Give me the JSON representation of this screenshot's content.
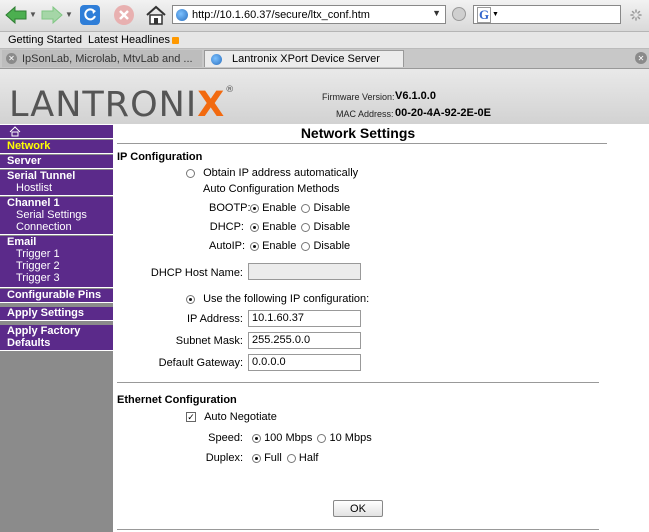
{
  "browser": {
    "url": "http://10.1.60.37/secure/ltx_conf.htm",
    "search_engine": "G",
    "bookmarks": [
      "Getting Started",
      "Latest Headlines"
    ],
    "tabs": [
      {
        "label": "IpSonLab, Microlab, MtvLab and ..."
      },
      {
        "label": "Lantronix XPort Device Server"
      }
    ],
    "colors": {
      "back": "#4caf50",
      "stop": "#d9534f"
    }
  },
  "header": {
    "logo_main": "LANTRONI",
    "logo_x": "X",
    "logo_reg": "®",
    "firmware_label": "Firmware Version:",
    "firmware_value": "V6.1.0.0",
    "mac_label": "MAC Address:",
    "mac_value": "00-20-4A-92-2E-0E"
  },
  "sidebar": {
    "items": [
      {
        "label": "Network"
      },
      {
        "label": "Server"
      },
      {
        "label": "Serial Tunnel"
      },
      {
        "label": "Hostlist"
      },
      {
        "label": "Channel 1"
      },
      {
        "label": "Serial Settings"
      },
      {
        "label": "Connection"
      },
      {
        "label": "Email"
      },
      {
        "label": "Trigger 1"
      },
      {
        "label": "Trigger 2"
      },
      {
        "label": "Trigger 3"
      },
      {
        "label": "Configurable Pins"
      },
      {
        "label": "Apply Settings"
      },
      {
        "label": "Apply Factory"
      },
      {
        "label": "Defaults"
      }
    ],
    "active_color": "#ffff00",
    "bg_color": "#5b2a8a"
  },
  "main": {
    "title": "Network Settings",
    "ip_section": "IP Configuration",
    "obtain_auto": "Obtain IP address automatically",
    "auto_methods": "Auto Configuration Methods",
    "bootp_label": "BOOTP:",
    "dhcp_label": "DHCP:",
    "autoip_label": "AutoIP:",
    "enable": "Enable",
    "disable": "Disable",
    "dhcp_host_label": "DHCP Host Name:",
    "dhcp_host_value": "",
    "use_following": "Use the following IP configuration:",
    "ip_label": "IP Address:",
    "ip_value": "10.1.60.37",
    "subnet_label": "Subnet Mask:",
    "subnet_value": "255.255.0.0",
    "gateway_label": "Default Gateway:",
    "gateway_value": "0.0.0.0",
    "eth_section": "Ethernet Configuration",
    "auto_negotiate": "Auto Negotiate",
    "auto_negotiate_check": "✓",
    "speed_label": "Speed:",
    "speed_100": "100 Mbps",
    "speed_10": "10 Mbps",
    "duplex_label": "Duplex:",
    "duplex_full": "Full",
    "duplex_half": "Half",
    "ok_label": "OK"
  }
}
